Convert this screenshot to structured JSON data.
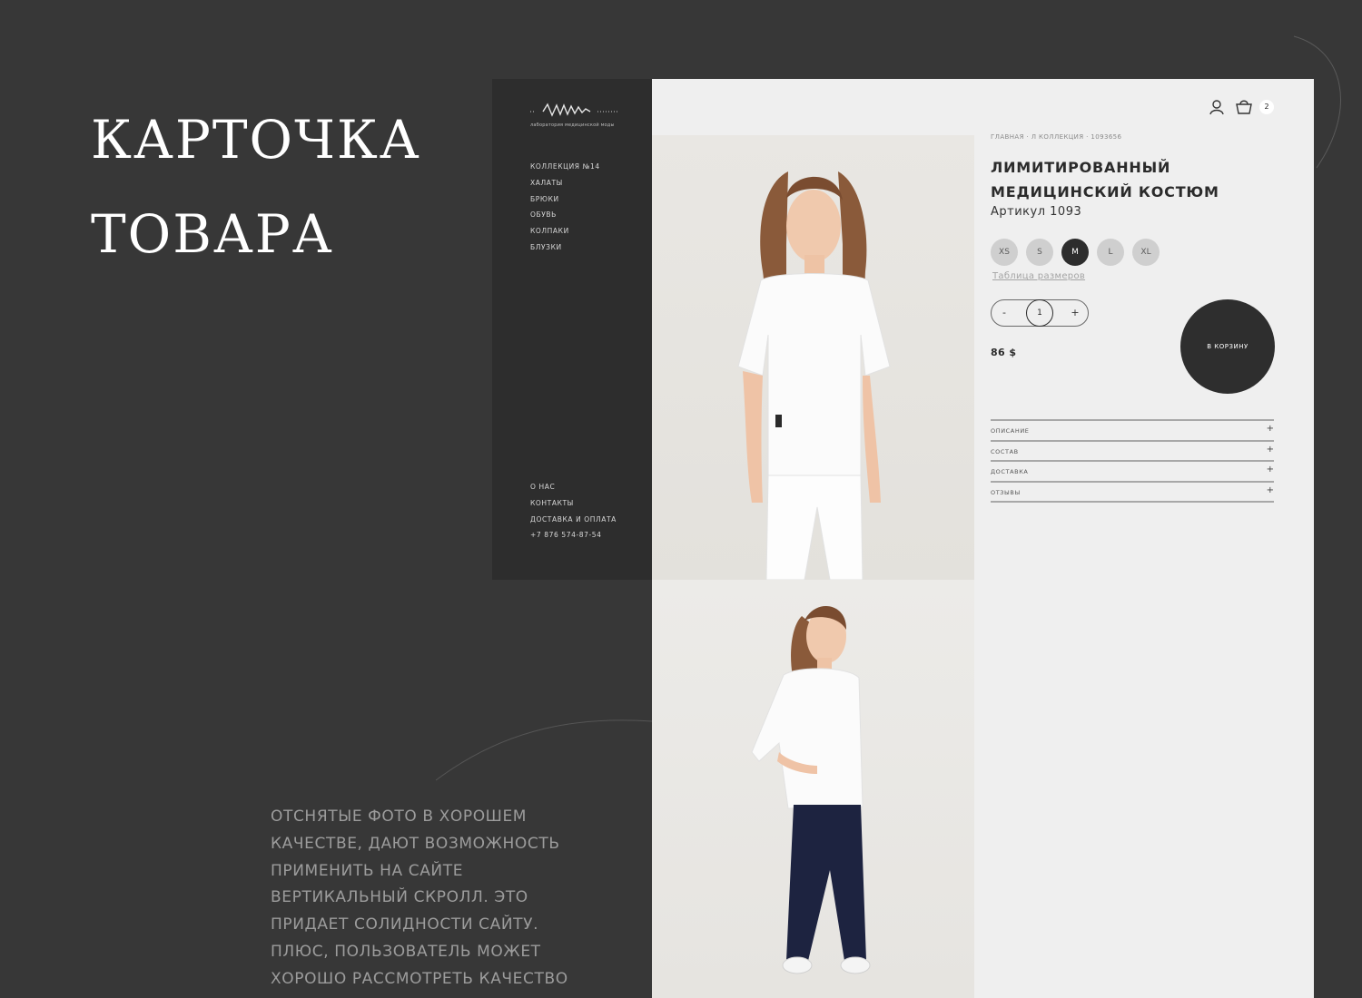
{
  "presentation": {
    "title_lines": [
      "КАРТОЧКА",
      "ТОВАРА"
    ],
    "description_lines": [
      "ОТСНЯТЫЕ ФОТО В ХОРОШЕМ",
      "КАЧЕСТВЕ, ДАЮТ ВОЗМОЖНОСТЬ",
      "ПРИМЕНИТЬ НА САЙТЕ",
      "ВЕРТИКАЛЬНЫЙ СКРОЛЛ. ЭТО",
      "ПРИДАЕТ СОЛИДНОСТИ САЙТУ.",
      "ПЛЮС, ПОЛЬЗОВАТЕЛЬ МОЖЕТ",
      "ХОРОШО РАССМОТРЕТЬ КАЧЕСТВО"
    ]
  },
  "sidebar": {
    "logo_subtitle": "лаборатория медицинской моды",
    "nav": [
      "КОЛЛЕКЦИЯ №14",
      "ХАЛАТЫ",
      "БРЮКИ",
      "ОБУВЬ",
      "КОЛПАКИ",
      "БЛУЗКИ"
    ],
    "footer_nav": [
      "О НАС",
      "КОНТАКТЫ",
      "ДОСТАВКА И ОПЛАТА",
      "+7 876 574-87-54"
    ]
  },
  "header": {
    "icons": [
      "user-icon",
      "cart-icon"
    ],
    "cart_count": "2"
  },
  "product": {
    "breadcrumb": "ГЛАВНАЯ · Л КОЛЛЕКЦИЯ · 1093656",
    "title_lines": [
      "ЛИМИТИРОВАННЫЙ",
      "МЕДИЦИНСКИЙ КОСТЮМ"
    ],
    "article": "Артикул 1093",
    "sizes": [
      "XS",
      "S",
      "M",
      "L",
      "XL"
    ],
    "selected_size": "M",
    "size_table_link": "Таблица размеров",
    "quantity": "1",
    "qty_minus": "-",
    "qty_plus": "+",
    "price": "86 $",
    "add_to_cart": "В КОРЗИНУ",
    "accordion": [
      {
        "label": "ОПИСАНИЕ",
        "icon": "+"
      },
      {
        "label": "СОСТАВ",
        "icon": "+"
      },
      {
        "label": "ДОСТАВКА",
        "icon": "+"
      },
      {
        "label": "ОТЗЫВЫ",
        "icon": "+"
      }
    ]
  },
  "colors": {
    "page_bg": "#373737",
    "sidebar_bg": "#2d2d2d",
    "content_bg": "#efefef",
    "accent_dark": "#2e2e2e",
    "size_chip": "#cfcfcf"
  }
}
